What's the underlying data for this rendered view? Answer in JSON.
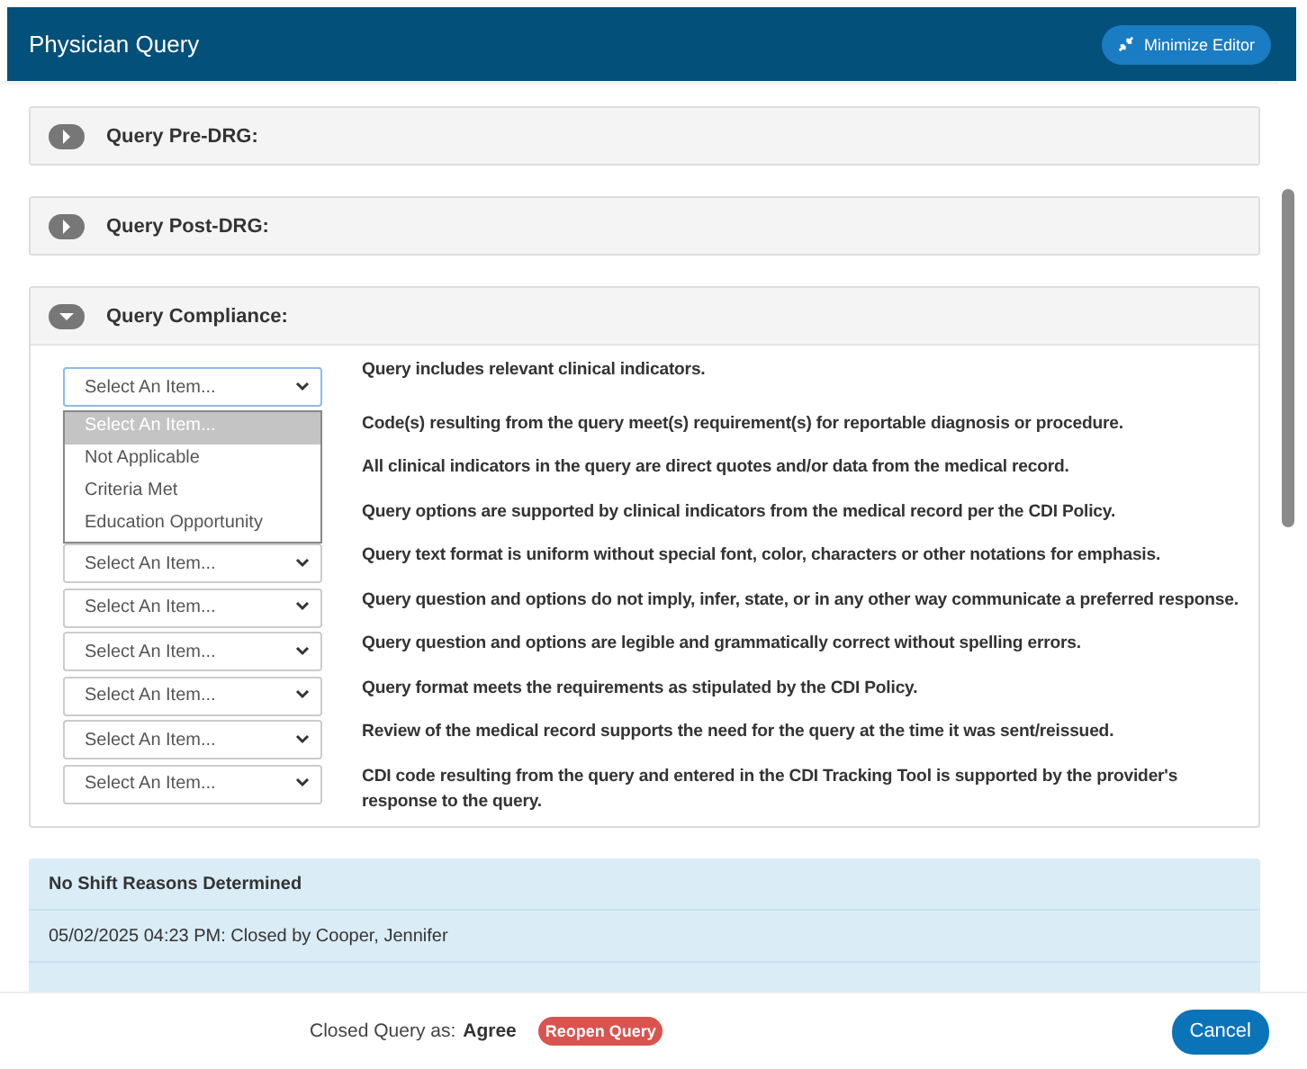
{
  "window": {
    "title": "Physician Query",
    "action_button": "Minimize Editor"
  },
  "sections": [
    {
      "title": "Query Pre-DRG:",
      "expanded": false
    },
    {
      "title": "Query Post-DRG:",
      "expanded": false
    },
    {
      "title": "Query Compliance:",
      "expanded": true
    }
  ],
  "compliance_items": [
    {
      "value": "Select An Item...",
      "question": "Query includes relevant clinical indicators.",
      "dropdown_open": true,
      "options": [
        {
          "label": "Select An Item...",
          "selected": true
        },
        {
          "label": "Not Applicable",
          "selected": false
        },
        {
          "label": "Criteria Met",
          "selected": false
        },
        {
          "label": "Education Opportunity",
          "selected": false
        }
      ]
    },
    {
      "question": "Code(s) resulting from the query meet(s) requirement(s) for reportable diagnosis or procedure."
    },
    {
      "question": "All clinical indicators in the query are direct quotes and/or data from the medical record."
    },
    {
      "question": "Query options are supported by clinical indicators from the medical record per the CDI Policy."
    },
    {
      "value": "Select An Item...",
      "question": "Query text format is uniform without special font, color, characters or other notations for emphasis."
    },
    {
      "value": "Select An Item...",
      "question": "Query question and options do not imply, infer, state, or in any other way communicate a preferred response."
    },
    {
      "value": "Select An Item...",
      "question": "Query question and options are legible and grammatically correct without spelling errors."
    },
    {
      "value": "Select An Item...",
      "question": "Query format meets the requirements as stipulated by the CDI Policy."
    },
    {
      "value": "Select An Item...",
      "question": "Review of the medical record supports the need for the query at the time it was sent/reissued."
    },
    {
      "value": "Select An Item...",
      "question": "CDI code resulting from the query and entered in the CDI Tracking Tool is supported by the provider's response to the query."
    }
  ],
  "history": {
    "title": "No Shift Reasons Determined",
    "entries": [
      "05/02/2025 04:23 PM: Closed by Cooper, Jennifer"
    ]
  },
  "footer": {
    "label": "Closed Query as:",
    "outcome": "Agree",
    "reopen_button": "Reopen Query",
    "cancel_button": "Cancel"
  }
}
